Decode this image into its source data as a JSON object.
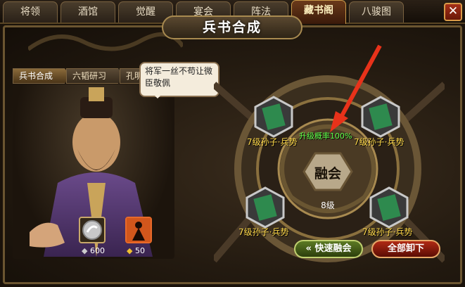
{
  "tabs": [
    {
      "label": "将领",
      "active": false
    },
    {
      "label": "酒馆",
      "active": false
    },
    {
      "label": "觉醒",
      "active": false
    },
    {
      "label": "宴会",
      "active": false
    },
    {
      "label": "阵法",
      "active": false
    },
    {
      "label": "藏书阁",
      "active": true
    },
    {
      "label": "八骏图",
      "active": false
    }
  ],
  "close_label": "✕",
  "title": "兵书合成",
  "subtabs": [
    "兵书合成",
    "六韬研习",
    "孔明兵法"
  ],
  "speech": "将军一丝不苟让微臣敬佩",
  "items": [
    {
      "icon": "silver-coin-icon",
      "count": "600"
    },
    {
      "icon": "warrior-scroll-icon",
      "count": "50"
    }
  ],
  "book_slots": [
    {
      "label": "7级孙子·兵势"
    },
    {
      "label": "7级孙子·兵势"
    },
    {
      "label": "7级孙子·兵势"
    },
    {
      "label": "7级孙子·兵势"
    }
  ],
  "upgrade_probability": "升级概率100%",
  "fuse_label": "融会",
  "result_level": "8级",
  "buttons": {
    "quick_fuse": "快速融会",
    "unload_all": "全部卸下"
  },
  "colors": {
    "accent": "#c99a4a",
    "probability": "#5dff4a",
    "book_label": "#ffd94a"
  }
}
